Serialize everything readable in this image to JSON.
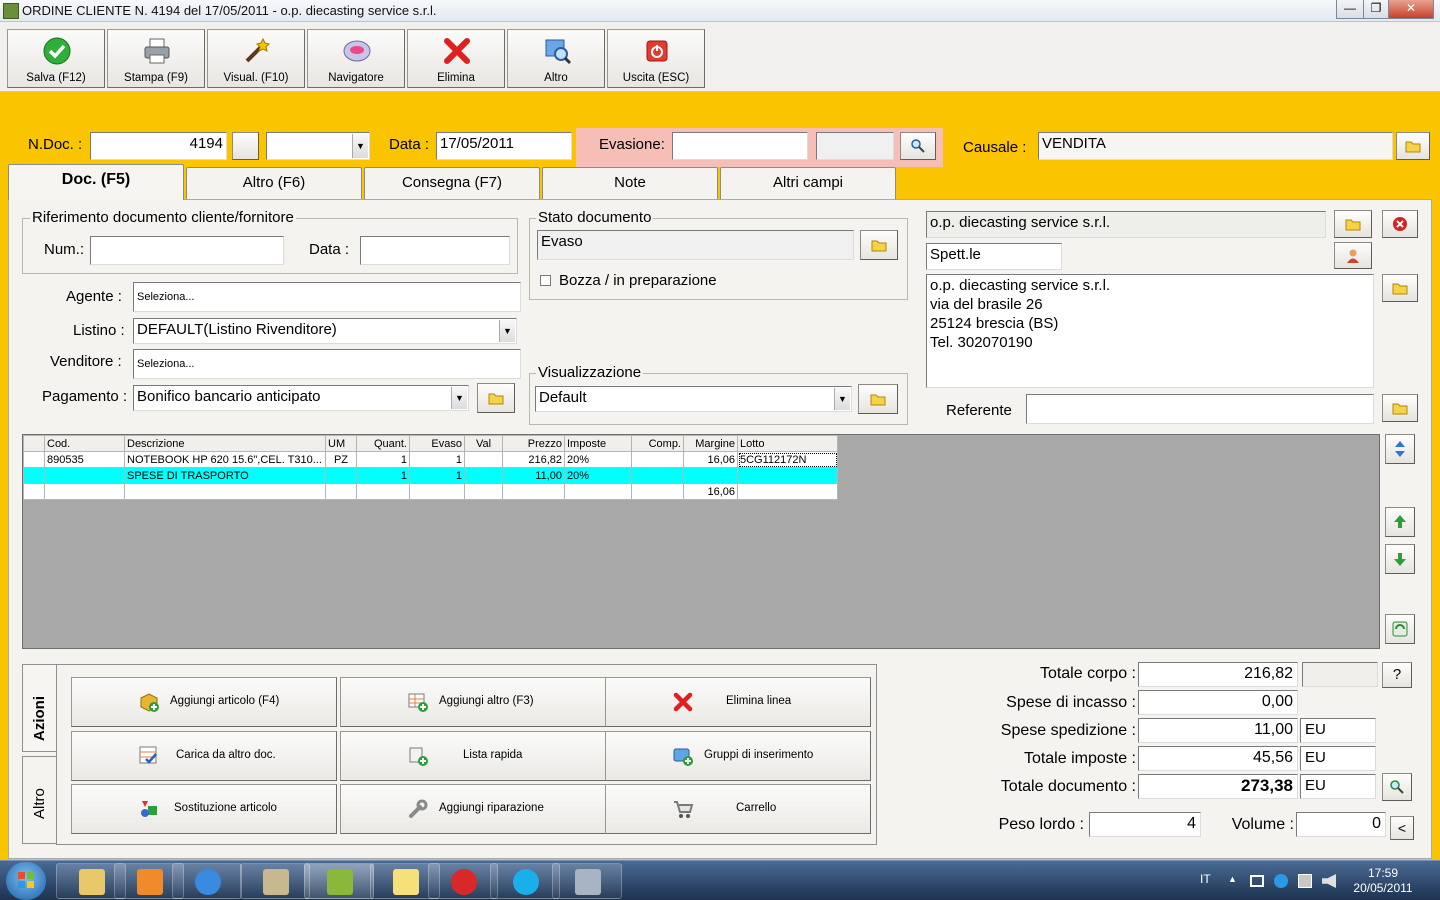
{
  "window": {
    "title": "ORDINE CLIENTE N. 4194  del 17/05/2011 - o.p. diecasting service s.r.l."
  },
  "toolbar": {
    "buttons": [
      {
        "label": "Salva (F12)",
        "icon": "check-icon"
      },
      {
        "label": "Stampa (F9)",
        "icon": "printer-icon"
      },
      {
        "label": "Visual. (F10)",
        "icon": "magic-wand-icon"
      },
      {
        "label": "Navigatore",
        "icon": "navigator-icon"
      },
      {
        "label": "Elimina",
        "icon": "delete-x-icon"
      },
      {
        "label": "Altro",
        "icon": "magnifier-icon"
      },
      {
        "label": "Uscita (ESC)",
        "icon": "power-icon"
      }
    ]
  },
  "header": {
    "ndoc_label": "N.Doc. :",
    "ndoc_value": "4194",
    "data_label": "Data :",
    "data_value": "17/05/2011",
    "evasione_label": "Evasione:",
    "evasione_value": "",
    "causale_label": "Causale :",
    "causale_value": "VENDITA"
  },
  "tabs": [
    "Doc. (F5)",
    "Altro (F6)",
    "Consegna (F7)",
    "Note",
    "Altri campi"
  ],
  "riferimento": {
    "title": "Riferimento documento cliente/fornitore",
    "num_label": "Num.:",
    "num_value": "",
    "data_label": "Data :",
    "data_value": ""
  },
  "stato": {
    "title": "Stato documento",
    "value": "Evaso",
    "bozza_label": "Bozza / in preparazione",
    "bozza_checked": false
  },
  "form": {
    "agente_label": "Agente :",
    "agente_value": "Seleziona...",
    "listino_label": "Listino :",
    "listino_value": "DEFAULT(Listino Rivenditore)",
    "venditore_label": "Venditore :",
    "venditore_value": "Seleziona...",
    "pagamento_label": "Pagamento :",
    "pagamento_value": "Bonifico bancario anticipato"
  },
  "visualizzazione": {
    "title": "Visualizzazione",
    "value": "Default"
  },
  "cliente": {
    "name": "o.p. diecasting service s.r.l.",
    "salutation": "Spett.le",
    "address_lines": [
      "o.p. diecasting service s.r.l.",
      "via del brasile 26",
      "25124 brescia (BS)",
      "Tel. 302070190"
    ],
    "referente_label": "Referente",
    "referente_value": ""
  },
  "grid": {
    "columns": [
      "Cod.",
      "Descrizione",
      "UM",
      "Quant.",
      "Evaso",
      "Val",
      "Prezzo",
      "Imposte",
      "Comp.",
      "Margine",
      "Lotto"
    ],
    "rows": [
      [
        "890535",
        "NOTEBOOK HP 620 15.6\",CEL. T310...",
        "PZ",
        "1",
        "1",
        "",
        "216,82",
        "20%",
        "",
        "16,06",
        "5CG112172N"
      ],
      [
        "",
        "SPESE DI TRASPORTO",
        "",
        "1",
        "1",
        "",
        "11,00",
        "20%",
        "",
        "",
        ""
      ],
      [
        "",
        "",
        "",
        "",
        "",
        "",
        "",
        "",
        "",
        "16,06",
        ""
      ]
    ]
  },
  "actions": {
    "vtab_azioni": "Azioni",
    "vtab_altro": "Altro",
    "buttons": [
      {
        "label": "Aggiungi articolo (F4)",
        "icon": "add-box-icon"
      },
      {
        "label": "Aggiungi altro (F3)",
        "icon": "add-grid-icon"
      },
      {
        "label": "Elimina linea",
        "icon": "delete-x-icon"
      },
      {
        "label": "Carica da altro doc.",
        "icon": "checklist-icon"
      },
      {
        "label": "Lista rapida",
        "icon": "quick-list-icon"
      },
      {
        "label": "Gruppi di inserimento",
        "icon": "group-add-icon"
      },
      {
        "label": "Sostituzione articolo",
        "icon": "replace-icon"
      },
      {
        "label": "Aggiungi riparazione",
        "icon": "wrench-icon"
      },
      {
        "label": "Carrello",
        "icon": "cart-icon"
      }
    ]
  },
  "totals": {
    "totale_corpo_label": "Totale corpo :",
    "totale_corpo": "216,82",
    "spese_incasso_label": "Spese di incasso :",
    "spese_incasso": "0,00",
    "spese_spedizione_label": "Spese spedizione :",
    "spese_spedizione": "11,00",
    "totale_imposte_label": "Totale imposte :",
    "totale_imposte": "45,56",
    "totale_documento_label": "Totale documento :",
    "totale_documento": "273,38",
    "currency": "EU",
    "peso_label": "Peso lordo :",
    "peso_value": "4",
    "volume_label": "Volume :",
    "volume_value": "0",
    "help_label": "?",
    "less_label": "<"
  },
  "taskbar": {
    "lang": "IT",
    "time": "17:59",
    "date": "20/05/2011"
  },
  "colors": {
    "accent": "#fbc400",
    "selected_row": "#00ffff",
    "evasione_bg": "#f7bdb7"
  }
}
